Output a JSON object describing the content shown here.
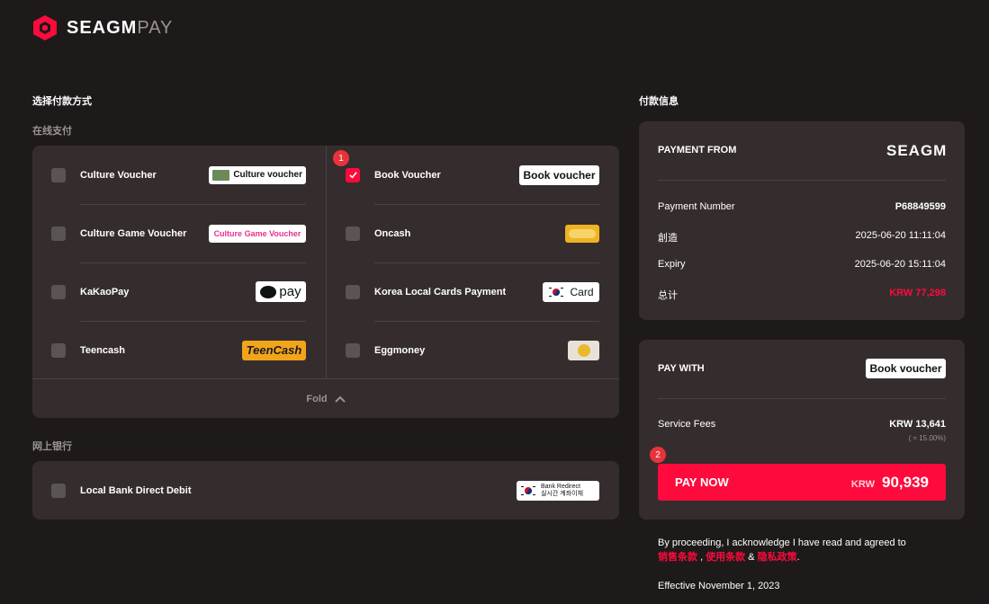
{
  "header": {
    "brand": "SEAGM",
    "pay": "PAY"
  },
  "left": {
    "title": "选择付款方式",
    "online_title": "在线支付",
    "bank_title": "网上银行",
    "fold_label": "Fold",
    "methods_left": [
      {
        "label": "Culture Voucher",
        "badge": "Culture voucher",
        "checked": false
      },
      {
        "label": "Culture Game Voucher",
        "badge": "Culture Game Voucher",
        "checked": false
      },
      {
        "label": "KaKaoPay",
        "badge": "pay",
        "checked": false
      },
      {
        "label": "Teencash",
        "badge": "TeenCash",
        "checked": false
      }
    ],
    "methods_right": [
      {
        "label": "Book Voucher",
        "badge": "Book voucher",
        "checked": true
      },
      {
        "label": "Oncash",
        "badge": "",
        "checked": false
      },
      {
        "label": "Korea Local Cards Payment",
        "badge": "Card",
        "checked": false
      },
      {
        "label": "Eggmoney",
        "badge": "",
        "checked": false
      }
    ],
    "bank_method": {
      "label": "Local Bank Direct Debit",
      "badge_line1": "Bank Redirect",
      "badge_line2": "실시간 계좌이체"
    },
    "step1": "1"
  },
  "right": {
    "title": "付款信息",
    "payment_from": "PAYMENT FROM",
    "brand": "SEAGM",
    "rows": [
      {
        "k": "Payment Number",
        "v": "P68849599"
      },
      {
        "k": "創造",
        "v": "2025-06-20 11:11:04"
      },
      {
        "k": "Expiry",
        "v": "2025-06-20 15:11:04"
      }
    ],
    "total_label": "总计",
    "total_value": "KRW 77,298",
    "pay_with": "PAY WITH",
    "pay_with_badge": "Book voucher",
    "service_fees_label": "Service Fees",
    "service_fees_value": "KRW 13,641",
    "service_fees_pct": "( ≈ 15.00%)",
    "step2": "2",
    "pay_now": "PAY NOW",
    "pay_currency": "KRW",
    "pay_amount": "90,939",
    "legal_text": "By proceeding, I acknowledge I have read and agreed to",
    "link1": "销售条款",
    "sep1": ",",
    "link2": "使用条款",
    "sep2": "&",
    "link3": "隐私政策",
    "end": ".",
    "effective": "Effective November 1, 2023"
  },
  "colors": {
    "accent": "#ff0a3c",
    "panel": "#352d2d",
    "bg": "#1e1a1a"
  }
}
